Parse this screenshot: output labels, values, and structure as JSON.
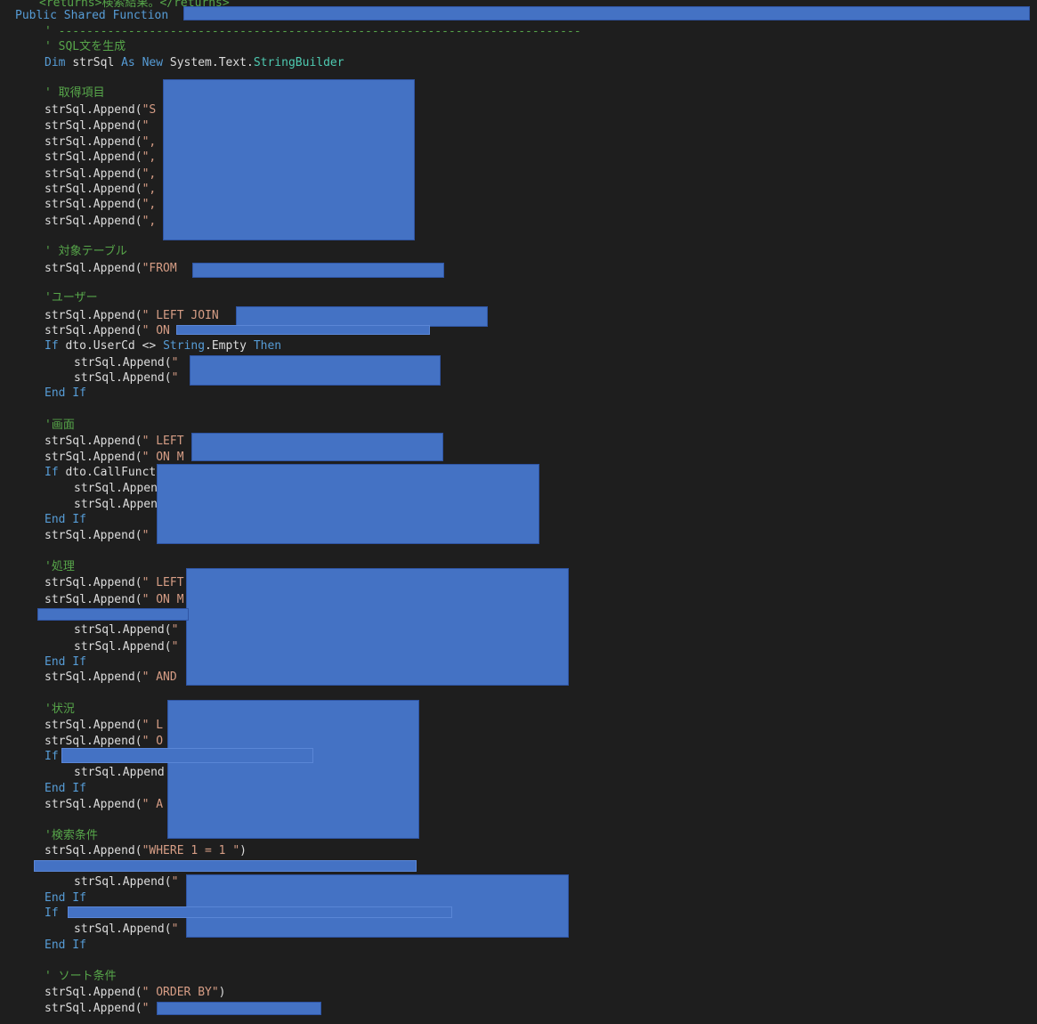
{
  "colors": {
    "background": "#1e1e1e",
    "keyword": "#569cd6",
    "type": "#4ec9b0",
    "string": "#d69d85",
    "comment": "#57a64a",
    "text": "#dcdcdc",
    "redaction": "#4472c4"
  },
  "lines": [
    {
      "segments": [
        {
          "t": "<returns>検索結果。</returns>",
          "c": "cm"
        }
      ]
    },
    {
      "segments": [
        {
          "t": "Public Shared Function ",
          "c": "kw"
        }
      ]
    },
    {
      "segments": [
        {
          "t": "' ---------------------------------------------------------------------------",
          "c": "cm"
        }
      ]
    },
    {
      "segments": [
        {
          "t": "' SQL文を生成",
          "c": "cm"
        }
      ]
    },
    {
      "segments": [
        {
          "t": "Dim ",
          "c": "kw"
        },
        {
          "t": "strSql ",
          "c": "default"
        },
        {
          "t": "As New ",
          "c": "kw"
        },
        {
          "t": "System.Text.",
          "c": "default"
        },
        {
          "t": "StringBuilder",
          "c": "type"
        }
      ]
    },
    {
      "segments": [
        {
          "t": "' 取得項目",
          "c": "cm"
        }
      ]
    },
    {
      "segments": [
        {
          "t": "strSql.Append(",
          "c": "default"
        },
        {
          "t": "\"S",
          "c": "str"
        }
      ]
    },
    {
      "segments": [
        {
          "t": "strSql.Append(",
          "c": "default"
        },
        {
          "t": "\"",
          "c": "str"
        }
      ]
    },
    {
      "segments": [
        {
          "t": "strSql.Append(",
          "c": "default"
        },
        {
          "t": "\",",
          "c": "str"
        }
      ]
    },
    {
      "segments": [
        {
          "t": "strSql.Append(",
          "c": "default"
        },
        {
          "t": "\",",
          "c": "str"
        }
      ]
    },
    {
      "segments": [
        {
          "t": "strSql.Append(",
          "c": "default"
        },
        {
          "t": "\",",
          "c": "str"
        }
      ]
    },
    {
      "segments": [
        {
          "t": "strSql.Append(",
          "c": "default"
        },
        {
          "t": "\",",
          "c": "str"
        }
      ]
    },
    {
      "segments": [
        {
          "t": "strSql.Append(",
          "c": "default"
        },
        {
          "t": "\",",
          "c": "str"
        }
      ]
    },
    {
      "segments": [
        {
          "t": "strSql.Append(",
          "c": "default"
        },
        {
          "t": "\",",
          "c": "str"
        }
      ]
    },
    {
      "segments": [
        {
          "t": "' 対象テーブル",
          "c": "cm"
        }
      ]
    },
    {
      "segments": [
        {
          "t": "strSql.Append(",
          "c": "default"
        },
        {
          "t": "\"FROM ",
          "c": "str"
        }
      ]
    },
    {
      "segments": [
        {
          "t": "'ユーザー",
          "c": "cm"
        }
      ]
    },
    {
      "segments": [
        {
          "t": "strSql.Append(",
          "c": "default"
        },
        {
          "t": "\" LEFT JOIN ",
          "c": "str"
        }
      ]
    },
    {
      "segments": [
        {
          "t": "strSql.Append(",
          "c": "default"
        },
        {
          "t": "\" ON",
          "c": "str"
        }
      ]
    },
    {
      "segments": [
        {
          "t": "If ",
          "c": "kw"
        },
        {
          "t": "dto.UserCd <> ",
          "c": "default"
        },
        {
          "t": "String",
          "c": "kw"
        },
        {
          "t": ".Empty ",
          "c": "default"
        },
        {
          "t": "Then",
          "c": "kw"
        }
      ]
    },
    {
      "segments": [
        {
          "t": "strSql.Append(",
          "c": "default"
        },
        {
          "t": "\"",
          "c": "str"
        }
      ]
    },
    {
      "segments": [
        {
          "t": "strSql.Append(",
          "c": "default"
        },
        {
          "t": "\"",
          "c": "str"
        }
      ]
    },
    {
      "segments": [
        {
          "t": "End If",
          "c": "kw"
        }
      ]
    },
    {
      "segments": [
        {
          "t": "'画面",
          "c": "cm"
        }
      ]
    },
    {
      "segments": [
        {
          "t": "strSql.Append(",
          "c": "default"
        },
        {
          "t": "\" LEFT",
          "c": "str"
        }
      ]
    },
    {
      "segments": [
        {
          "t": "strSql.Append(",
          "c": "default"
        },
        {
          "t": "\" ON M",
          "c": "str"
        }
      ]
    },
    {
      "segments": [
        {
          "t": "If ",
          "c": "kw"
        },
        {
          "t": "dto.CallFunct",
          "c": "default"
        }
      ]
    },
    {
      "segments": [
        {
          "t": "strSql.Appen",
          "c": "default"
        }
      ]
    },
    {
      "segments": [
        {
          "t": "strSql.Appen",
          "c": "default"
        }
      ]
    },
    {
      "segments": [
        {
          "t": "End If",
          "c": "kw"
        }
      ]
    },
    {
      "segments": [
        {
          "t": "strSql.Append(",
          "c": "default"
        },
        {
          "t": "\"",
          "c": "str"
        }
      ]
    },
    {
      "segments": [
        {
          "t": "'処理",
          "c": "cm"
        }
      ]
    },
    {
      "segments": [
        {
          "t": "strSql.Append(",
          "c": "default"
        },
        {
          "t": "\" LEFT",
          "c": "str"
        }
      ]
    },
    {
      "segments": [
        {
          "t": "strSql.Append(",
          "c": "default"
        },
        {
          "t": "\" ON M",
          "c": "str"
        }
      ]
    },
    {
      "segments": [
        {
          "t": "strSql.Append(",
          "c": "default"
        },
        {
          "t": "\"",
          "c": "str"
        }
      ]
    },
    {
      "segments": [
        {
          "t": "strSql.Append(",
          "c": "default"
        },
        {
          "t": "\"",
          "c": "str"
        }
      ]
    },
    {
      "segments": [
        {
          "t": "End If",
          "c": "kw"
        }
      ]
    },
    {
      "segments": [
        {
          "t": "strSql.Append(",
          "c": "default"
        },
        {
          "t": "\" AND",
          "c": "str"
        }
      ]
    },
    {
      "segments": [
        {
          "t": "'状況",
          "c": "cm"
        }
      ]
    },
    {
      "segments": [
        {
          "t": "strSql.Append(",
          "c": "default"
        },
        {
          "t": "\" L",
          "c": "str"
        }
      ]
    },
    {
      "segments": [
        {
          "t": "strSql.Append(",
          "c": "default"
        },
        {
          "t": "\" O",
          "c": "str"
        }
      ]
    },
    {
      "segments": [
        {
          "t": "If",
          "c": "kw"
        }
      ]
    },
    {
      "segments": [
        {
          "t": "strSql.Append",
          "c": "default"
        }
      ]
    },
    {
      "segments": [
        {
          "t": "End If",
          "c": "kw"
        }
      ]
    },
    {
      "segments": [
        {
          "t": "strSql.Append(",
          "c": "default"
        },
        {
          "t": "\" A",
          "c": "str"
        }
      ]
    },
    {
      "segments": [
        {
          "t": "'検索条件",
          "c": "cm"
        }
      ]
    },
    {
      "segments": [
        {
          "t": "strSql.Append(",
          "c": "default"
        },
        {
          "t": "\"WHERE 1 = 1 \"",
          "c": "str"
        },
        {
          "t": ")",
          "c": "default"
        }
      ]
    },
    {
      "segments": [
        {
          "t": "strSql.Append(",
          "c": "default"
        },
        {
          "t": "\"",
          "c": "str"
        }
      ]
    },
    {
      "segments": [
        {
          "t": "End If",
          "c": "kw"
        }
      ]
    },
    {
      "segments": [
        {
          "t": "If",
          "c": "kw"
        }
      ]
    },
    {
      "segments": [
        {
          "t": "strSql.Append(",
          "c": "default"
        },
        {
          "t": "\"",
          "c": "str"
        }
      ]
    },
    {
      "segments": [
        {
          "t": "End If",
          "c": "kw"
        }
      ]
    },
    {
      "segments": [
        {
          "t": "' ソート条件",
          "c": "cm"
        }
      ]
    },
    {
      "segments": [
        {
          "t": "strSql.Append(",
          "c": "default"
        },
        {
          "t": "\" ORDER BY\"",
          "c": "str"
        },
        {
          "t": ")",
          "c": "default"
        }
      ]
    },
    {
      "segments": [
        {
          "t": "strSql.Append(",
          "c": "default"
        },
        {
          "t": "\"",
          "c": "str"
        }
      ]
    }
  ]
}
